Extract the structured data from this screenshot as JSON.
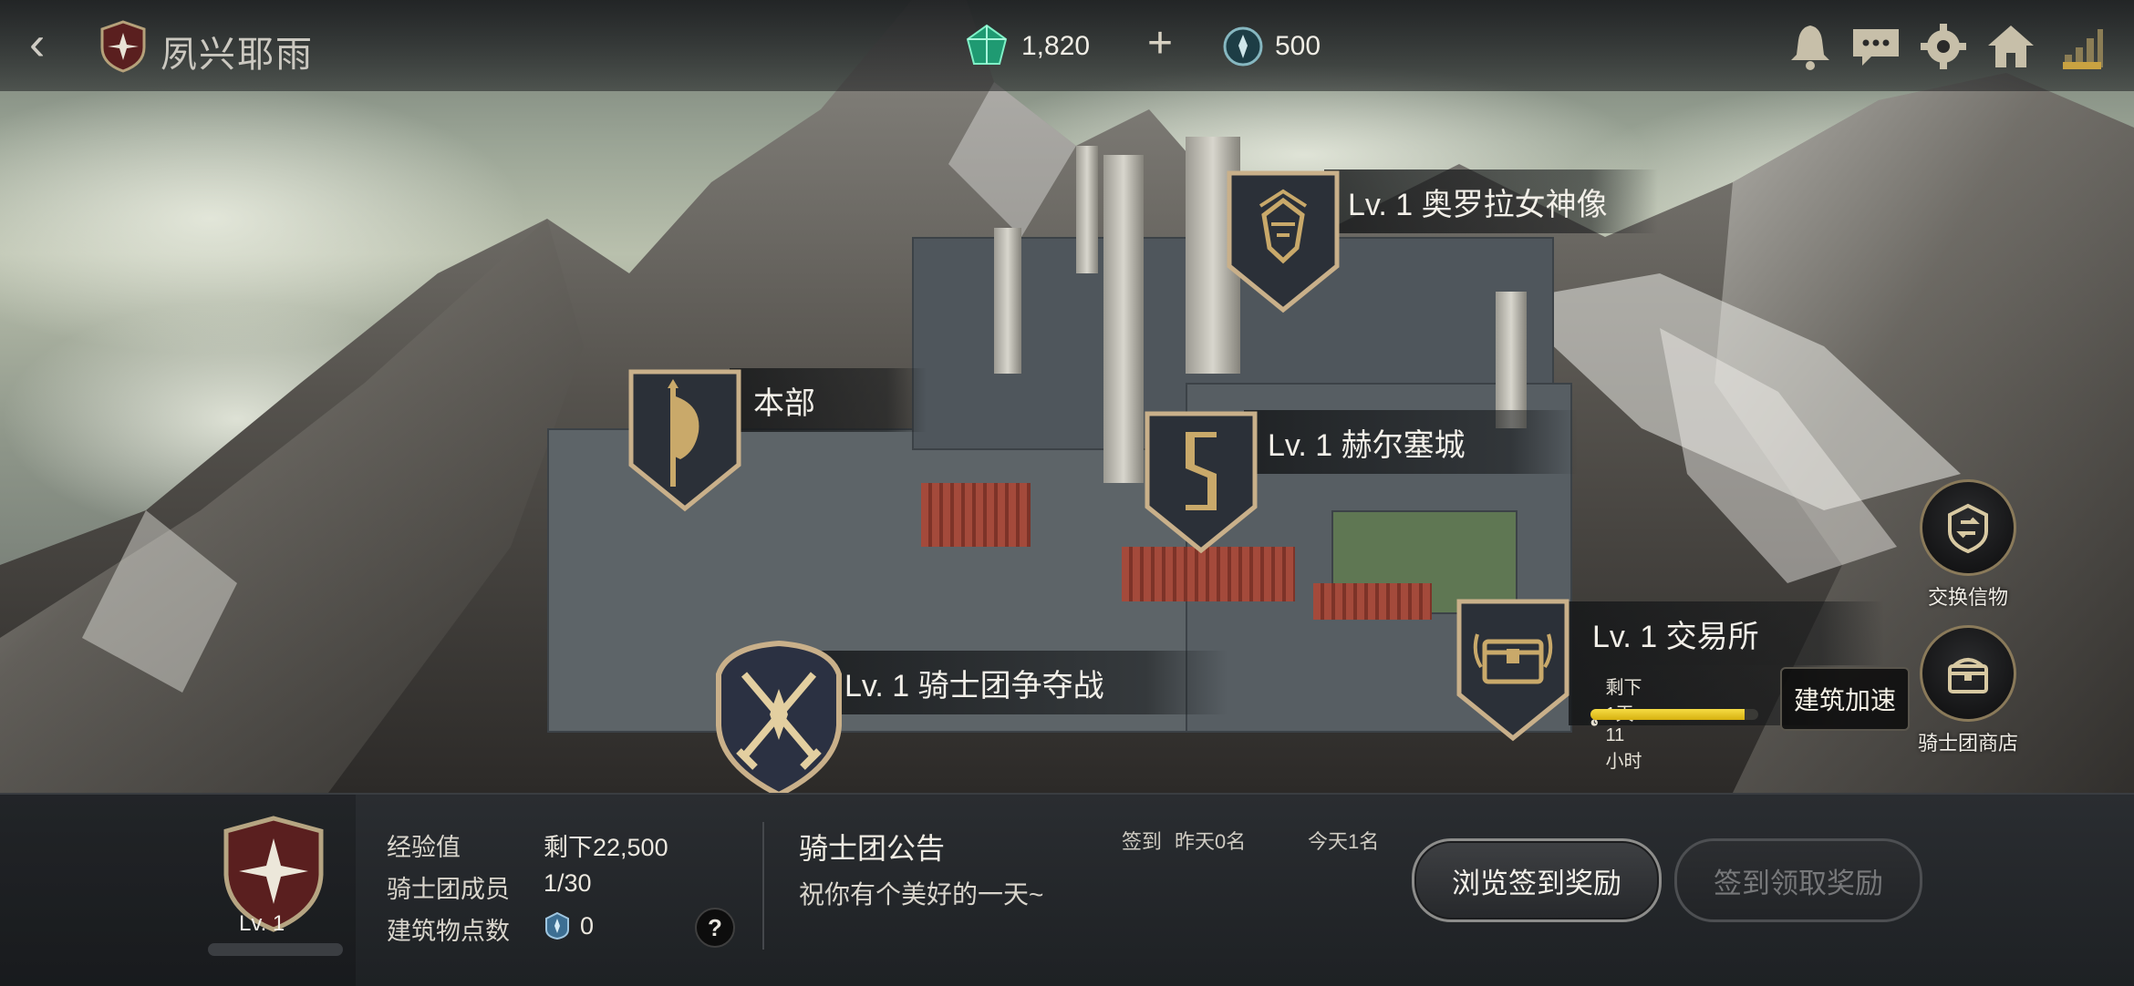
{
  "header": {
    "guild_name": "夙兴耶雨",
    "gems": "1,820",
    "tokens": "500"
  },
  "top_icons": [
    "bell-icon",
    "chat-icon",
    "gear-icon",
    "home-icon",
    "signal-icon"
  ],
  "buildings": {
    "statue": {
      "label": "Lv. 1  奥罗拉女神像"
    },
    "hq": {
      "label": "本部"
    },
    "castle": {
      "label": "Lv. 1  赫尔塞城"
    },
    "guild_war": {
      "label": "Lv. 1  骑士团争夺战"
    },
    "exchange": {
      "label": "Lv. 1  交易所",
      "timer": "剩下1天11小时",
      "progress": 0.92,
      "speed_up": "建筑加速"
    }
  },
  "side_buttons": {
    "exchange_items": "交换信物",
    "guild_shop": "骑士团商店"
  },
  "guild_panel": {
    "level": "Lv. 1",
    "exp_label": "经验值",
    "exp_value": "剩下22,500",
    "members_label": "骑士团成员",
    "members_value": "1/30",
    "points_label": "建筑物点数",
    "points_value": "0",
    "help": "?"
  },
  "notice": {
    "title": "骑士团公告",
    "text": "祝你有个美好的一天~",
    "checkin_label": "签到",
    "yesterday": "昨天0名",
    "today": "今天1名"
  },
  "buttons": {
    "browse_rewards": "浏览签到奖励",
    "claim_rewards": "签到领取奖励"
  },
  "colors": {
    "accent_gold": "#c9a96a",
    "progress_yellow": "#f2d22a",
    "panel_bg": "#23262a"
  }
}
